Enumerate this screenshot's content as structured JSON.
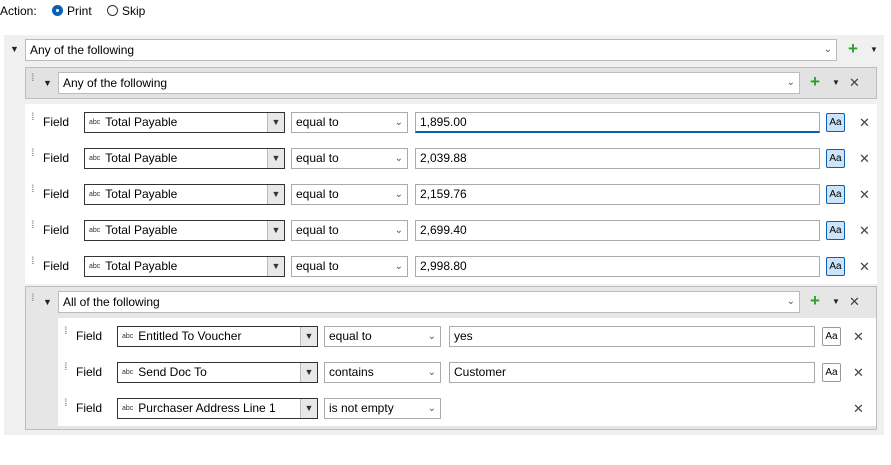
{
  "action": {
    "label": "Action:",
    "options": [
      {
        "label": "Print",
        "checked": true
      },
      {
        "label": "Skip",
        "checked": false
      }
    ]
  },
  "root_group": {
    "mode": "Any of the following"
  },
  "group1": {
    "mode": "Any of the following",
    "rows": [
      {
        "field_label": "Field",
        "field": "Total Payable",
        "operator": "equal to",
        "value": "1,895.00",
        "case_sensitive": true
      },
      {
        "field_label": "Field",
        "field": "Total Payable",
        "operator": "equal to",
        "value": "2,039.88",
        "case_sensitive": true
      },
      {
        "field_label": "Field",
        "field": "Total Payable",
        "operator": "equal to",
        "value": "2,159.76",
        "case_sensitive": true
      },
      {
        "field_label": "Field",
        "field": "Total Payable",
        "operator": "equal to",
        "value": "2,699.40",
        "case_sensitive": true
      },
      {
        "field_label": "Field",
        "field": "Total Payable",
        "operator": "equal to",
        "value": "2,998.80",
        "case_sensitive": true
      }
    ]
  },
  "group2": {
    "mode": "All of the following",
    "rows": [
      {
        "field_label": "Field",
        "field": "Entitled To Voucher",
        "operator": "equal to",
        "value": "yes",
        "case_sensitive": false
      },
      {
        "field_label": "Field",
        "field": "Send Doc To",
        "operator": "contains",
        "value": "Customer",
        "case_sensitive": false
      },
      {
        "field_label": "Field",
        "field": "Purchaser Address Line 1",
        "operator": "is not empty",
        "value": "",
        "case_sensitive": null
      }
    ]
  },
  "labels": {
    "abc": "abc",
    "aa": "Aa"
  },
  "icons": {
    "expand": "caret-down-icon",
    "add": "plus-icon",
    "remove": "close-icon",
    "drag": "drag-handle-icon",
    "dropdown": "chevron-down-icon"
  },
  "colors": {
    "accent": "#0a5fb4",
    "add_green": "#2f9e2f",
    "case_on_bg": "#cde4f8"
  }
}
